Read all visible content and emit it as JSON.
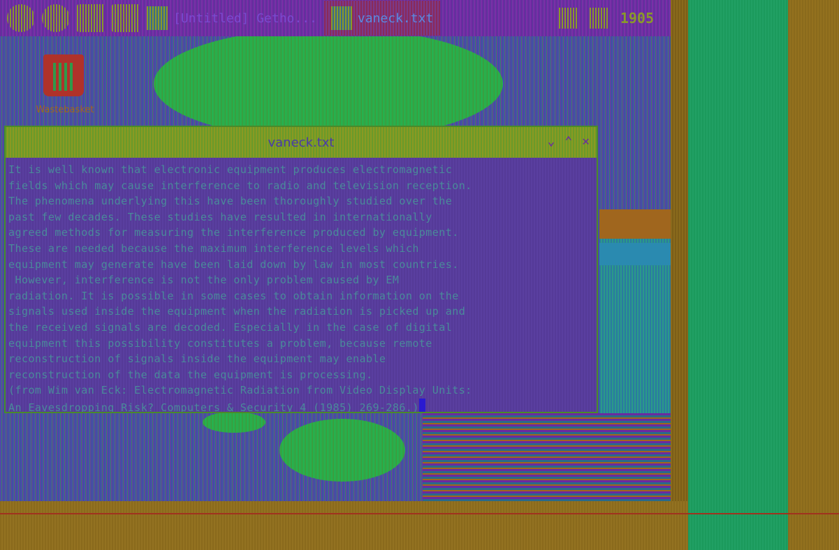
{
  "taskbar": {
    "tasks": [
      {
        "label": "[Untitled] Getho..."
      },
      {
        "label": "vaneck.txt"
      }
    ],
    "clock": "1905"
  },
  "desktop": {
    "trash_label": "Wastebasket"
  },
  "window": {
    "title": "vaneck.txt",
    "controls": {
      "minimize": "⌄",
      "maximize": "⌃",
      "close": "✕"
    },
    "lines": [
      "It is well known that electronic equipment produces electromagnetic",
      "fields which may cause interference to radio and television reception.",
      "The phenomena underlying this have been thoroughly studied over the",
      "past few decades. These studies have resulted in internationally",
      "agreed methods for measuring the interference produced by equipment.",
      "These are needed because the maximum interference levels which",
      "equipment may generate have been laid down by law in most countries.",
      " However, interference is not the only problem caused by EM",
      "radiation. It is possible in some cases to obtain information on the",
      "signals used inside the equipment when the radiation is picked up and",
      "the received signals are decoded. Especially in the case of digital",
      "equipment this possibility constitutes a problem, because remote",
      "reconstruction of signals inside the equipment may enable",
      "reconstruction of the data the equipment is processing.",
      "(from Wim van Eck: Electromagnetic Radiation from Video Display Units:",
      "An Eavesdropping Risk? Computers & Security 4 (1985) 269-286.)"
    ]
  },
  "colors": {
    "desktop": "#4f4aa8",
    "taskbar": "#6a2aa0",
    "editor_bg": "#5a3fa0",
    "text": "#4a8a9a",
    "titlebar": "#8a9a22",
    "green_band": "#1b9a5c",
    "mustard": "#8a6a1c"
  }
}
